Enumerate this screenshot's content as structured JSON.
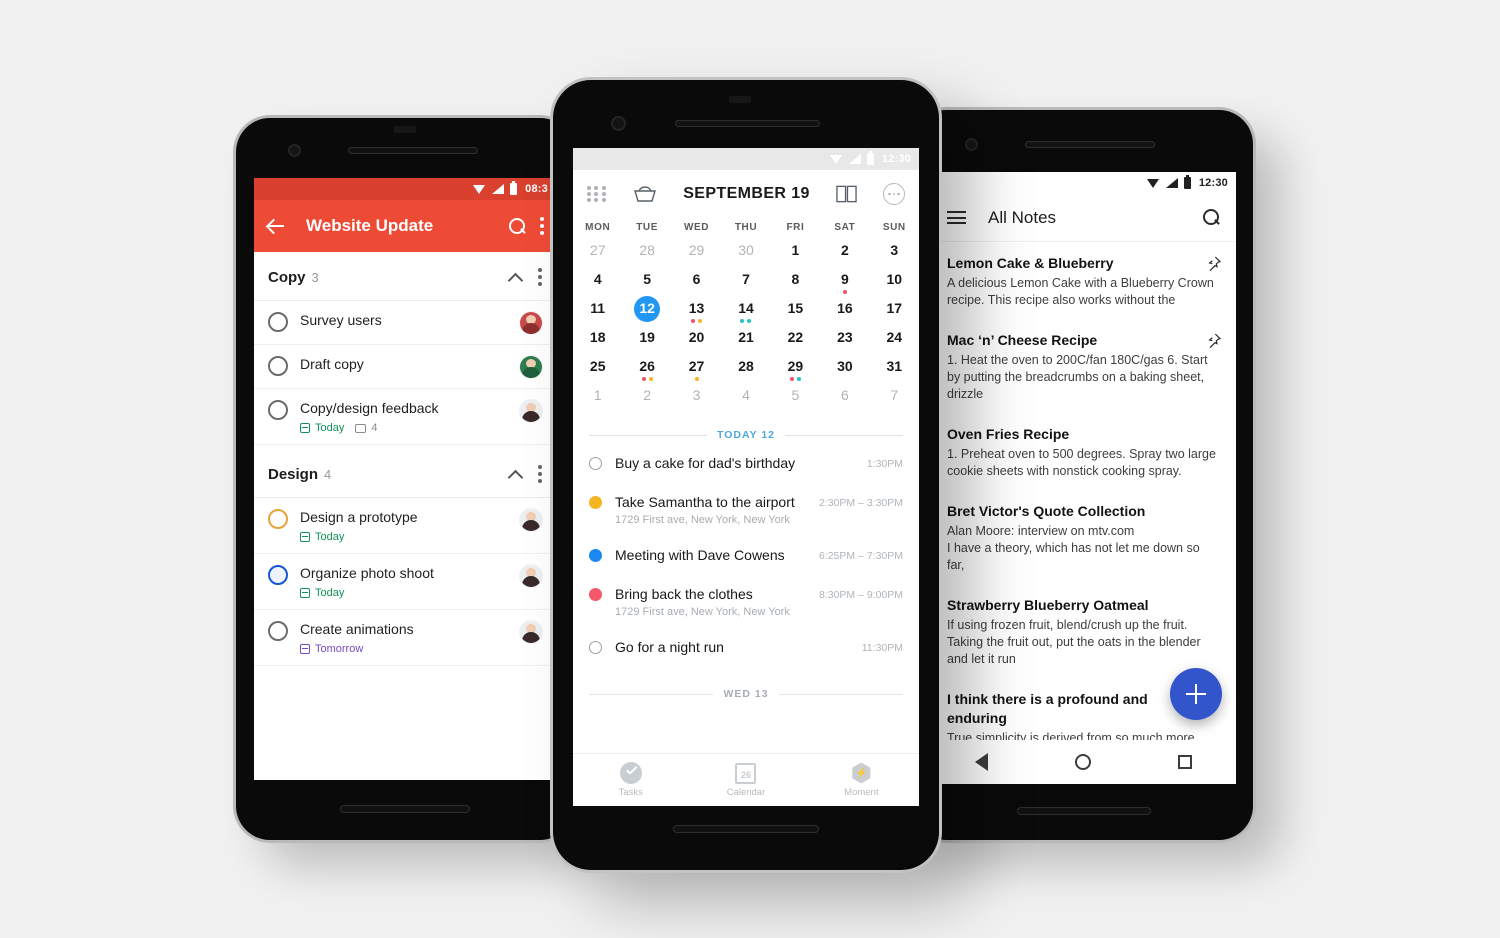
{
  "background_color": "#f1f1f1",
  "left_phone": {
    "app": "tasks",
    "status_bar": {
      "time": "08:3",
      "wifi_icon": "wifi-icon",
      "signal_icon": "signal-icon",
      "battery_icon": "battery-icon"
    },
    "appbar": {
      "back_icon": "arrow-left-icon",
      "title": "Website Update",
      "search_icon": "search-icon",
      "overflow_icon": "kebab-menu-icon",
      "accent_color": "#ee4b36"
    },
    "sections": [
      {
        "name": "Copy",
        "count": "3",
        "collapse_icon": "chevron-up-icon",
        "overflow_icon": "kebab-menu-icon",
        "tasks": [
          {
            "title": "Survey users",
            "checkbox": "unchecked",
            "checkbox_color": "#6b6b6b",
            "due": "",
            "comments": "",
            "avatar": "avatar-1"
          },
          {
            "title": "Draft copy",
            "checkbox": "unchecked",
            "checkbox_color": "#6b6b6b",
            "due": "",
            "comments": "",
            "avatar": "avatar-2"
          },
          {
            "title": "Copy/design feedback",
            "checkbox": "unchecked",
            "checkbox_color": "#6b6b6b",
            "due": "Today",
            "due_color": "#12915a",
            "comments": "4",
            "avatar": "avatar-3"
          }
        ]
      },
      {
        "name": "Design",
        "count": "4",
        "collapse_icon": "chevron-up-icon",
        "overflow_icon": "kebab-menu-icon",
        "tasks": [
          {
            "title": "Design a prototype",
            "checkbox": "unchecked",
            "checkbox_color": "#e8a33d",
            "due": "Today",
            "due_color": "#12915a",
            "comments": "",
            "avatar": "avatar-3"
          },
          {
            "title": "Organize photo shoot",
            "checkbox": "unchecked",
            "checkbox_color": "#1558d6",
            "due": "Today",
            "due_color": "#12915a",
            "comments": "",
            "avatar": "avatar-3"
          },
          {
            "title": "Create animations",
            "checkbox": "unchecked",
            "checkbox_color": "#6b6b6b",
            "due": "Tomorrow",
            "due_color": "#7848c6",
            "comments": "",
            "avatar": "avatar-3"
          }
        ]
      }
    ]
  },
  "center_phone": {
    "app": "calendar",
    "status_bar": {
      "time": "12:30",
      "wifi_icon": "wifi-icon",
      "signal_icon": "signal-icon",
      "battery_icon": "battery-icon"
    },
    "toolbar": {
      "apps_icon": "grid-apps-icon",
      "basket_icon": "basket-icon",
      "month_title": "SEPTEMBER 19",
      "view_icon": "two-column-view-icon",
      "more_icon": "more-circle-icon"
    },
    "weekday_headers": [
      "MON",
      "TUE",
      "WED",
      "THU",
      "FRI",
      "SAT",
      "SUN"
    ],
    "weeks": [
      [
        {
          "day": "27",
          "muted": true,
          "dots": []
        },
        {
          "day": "28",
          "muted": true,
          "dots": []
        },
        {
          "day": "29",
          "muted": true,
          "dots": []
        },
        {
          "day": "30",
          "muted": true,
          "dots": []
        },
        {
          "day": "1",
          "muted": false,
          "dots": []
        },
        {
          "day": "2",
          "muted": false,
          "dots": []
        },
        {
          "day": "3",
          "muted": false,
          "dots": []
        }
      ],
      [
        {
          "day": "4",
          "muted": false,
          "dots": []
        },
        {
          "day": "5",
          "muted": false,
          "dots": []
        },
        {
          "day": "6",
          "muted": false,
          "dots": []
        },
        {
          "day": "7",
          "muted": false,
          "dots": []
        },
        {
          "day": "8",
          "muted": false,
          "dots": []
        },
        {
          "day": "9",
          "muted": false,
          "dots": [
            "#f2516b"
          ]
        },
        {
          "day": "10",
          "muted": false,
          "dots": []
        }
      ],
      [
        {
          "day": "11",
          "muted": false,
          "dots": []
        },
        {
          "day": "12",
          "muted": false,
          "today": true,
          "today_color": "#2196f3",
          "dots": []
        },
        {
          "day": "13",
          "muted": false,
          "dots": [
            "#f2516b",
            "#f5b520"
          ]
        },
        {
          "day": "14",
          "muted": false,
          "dots": [
            "#22c3c9",
            "#22c3c9"
          ]
        },
        {
          "day": "15",
          "muted": false,
          "dots": []
        },
        {
          "day": "16",
          "muted": false,
          "dots": []
        },
        {
          "day": "17",
          "muted": false,
          "dots": []
        }
      ],
      [
        {
          "day": "18",
          "muted": false,
          "dots": []
        },
        {
          "day": "19",
          "muted": false,
          "dots": []
        },
        {
          "day": "20",
          "muted": false,
          "dots": []
        },
        {
          "day": "21",
          "muted": false,
          "dots": []
        },
        {
          "day": "22",
          "muted": false,
          "dots": []
        },
        {
          "day": "23",
          "muted": false,
          "dots": []
        },
        {
          "day": "24",
          "muted": false,
          "dots": []
        }
      ],
      [
        {
          "day": "25",
          "muted": false,
          "dots": []
        },
        {
          "day": "26",
          "muted": false,
          "dots": [
            "#f2516b",
            "#f5b520"
          ]
        },
        {
          "day": "27",
          "muted": false,
          "dots": [
            "#f5b520"
          ]
        },
        {
          "day": "28",
          "muted": false,
          "dots": []
        },
        {
          "day": "29",
          "muted": false,
          "dots": [
            "#f2516b",
            "#22c3c9"
          ]
        },
        {
          "day": "30",
          "muted": false,
          "dots": []
        },
        {
          "day": "31",
          "muted": false,
          "dots": []
        }
      ],
      [
        {
          "day": "1",
          "muted": true,
          "dots": []
        },
        {
          "day": "2",
          "muted": true,
          "dots": []
        },
        {
          "day": "3",
          "muted": true,
          "dots": []
        },
        {
          "day": "4",
          "muted": true,
          "dots": []
        },
        {
          "day": "5",
          "muted": true,
          "dots": []
        },
        {
          "day": "6",
          "muted": true,
          "dots": []
        },
        {
          "day": "7",
          "muted": true,
          "dots": []
        }
      ]
    ],
    "day_groups": [
      {
        "label": "TODAY 12",
        "accent": "#4fa8dd"
      },
      {
        "label": "WED 13",
        "accent": "#a7adb2"
      }
    ],
    "events": [
      {
        "title": "Buy a cake for dad's birthday",
        "location": "",
        "time": "1:30PM",
        "bullet": "hollow",
        "bullet_color": ""
      },
      {
        "title": "Take Samantha to the airport",
        "location": "1729 First ave, New York, New York",
        "time": "2:30PM – 3:30PM",
        "bullet": "solid",
        "bullet_color": "#f5b520"
      },
      {
        "title": "Meeting with Dave Cowens",
        "location": "",
        "time": "6:25PM – 7:30PM",
        "bullet": "solid",
        "bullet_color": "#1b87f0"
      },
      {
        "title": "Bring back the clothes",
        "location": "1729 First ave, New York, New York",
        "time": "8:30PM – 9:00PM",
        "bullet": "solid",
        "bullet_color": "#f4596b"
      },
      {
        "title": "Go for a night run",
        "location": "",
        "time": "11:30PM",
        "bullet": "hollow",
        "bullet_color": ""
      }
    ],
    "tabs": [
      {
        "label": "Tasks",
        "icon": "check-circle-icon"
      },
      {
        "label": "Calendar",
        "icon": "calendar-icon",
        "badge": "26"
      },
      {
        "label": "Moment",
        "icon": "hexagon-bolt-icon"
      }
    ]
  },
  "right_phone": {
    "app": "notes",
    "status_bar": {
      "time": "12:30",
      "wifi_icon": "wifi-icon",
      "signal_icon": "signal-icon",
      "battery_icon": "battery-icon"
    },
    "appbar": {
      "menu_icon": "hamburger-menu-icon",
      "title": "All Notes",
      "search_icon": "search-icon"
    },
    "notes": [
      {
        "title": "Lemon Cake & Blueberry",
        "body": "A delicious Lemon Cake with a Blueberry Crown recipe. This recipe also works without the",
        "pinned": true,
        "pin_icon": "pin-icon"
      },
      {
        "title": "Mac ‘n’ Cheese Recipe",
        "body": "1. Heat the oven to 200C/fan 180C/gas 6. Start by putting the breadcrumbs on a baking sheet, drizzle",
        "pinned": true,
        "pin_icon": "pin-icon"
      },
      {
        "title": "Oven Fries Recipe",
        "body": "1. Preheat oven to 500 degrees. Spray two large cookie sheets with nonstick cooking spray.",
        "pinned": false
      },
      {
        "title": "Bret Victor's Quote Collection",
        "body": "Alan Moore: interview on mtv.com\nI have a theory, which has not let me down so far,",
        "pinned": false
      },
      {
        "title": "Strawberry Blueberry Oatmeal",
        "body": "If using frozen fruit, blend/crush up the fruit. Taking the fruit out, put the oats in the blender and let it run",
        "pinned": false
      },
      {
        "title": "I think there is a profound and enduring",
        "body": "True simplicity is derived from so much more than",
        "pinned": false
      }
    ],
    "fab": {
      "icon": "plus-icon",
      "color": "#3355cc"
    },
    "nav_bar": {
      "back_icon": "nav-back-icon",
      "home_icon": "nav-home-icon",
      "recents_icon": "nav-recents-icon"
    }
  }
}
